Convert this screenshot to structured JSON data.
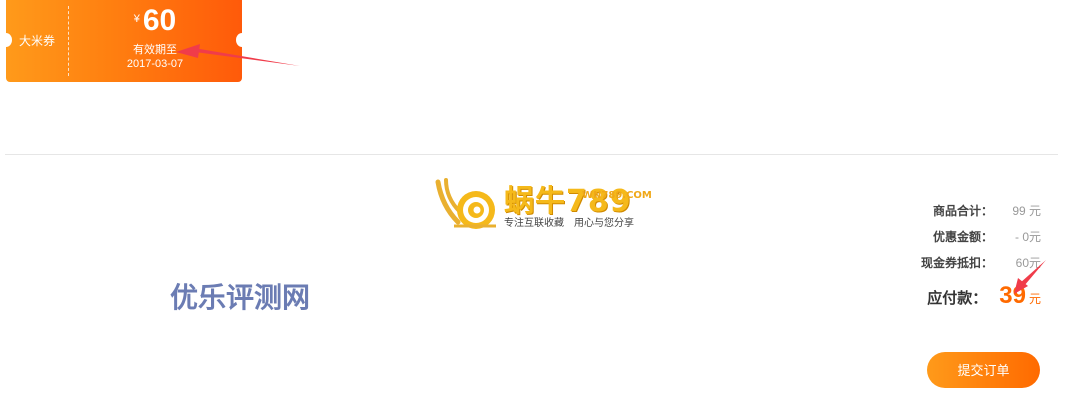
{
  "coupon": {
    "type_label": "大米券",
    "currency": "¥",
    "amount": "60",
    "valid_label": "有效期至",
    "valid_date": "2017-03-07"
  },
  "logo": {
    "brand": "蜗牛789",
    "domain": "WN789.COM",
    "slogan": "专注互联收藏　用心与您分享",
    "icon": "snail-icon"
  },
  "watermark": "优乐评测网",
  "summary": {
    "subtotal_label": "商品合计：",
    "subtotal_value": "99 元",
    "discount_label": "优惠金额：",
    "discount_value": "- 0元",
    "voucher_label": "现金券抵扣：",
    "voucher_value": "60元",
    "payable_label": "应付款：",
    "payable_amount": "39",
    "payable_unit": "元"
  },
  "submit_label": "提交订单",
  "colors": {
    "accent": "#ff6a00",
    "coupon_start": "#ff9a1a",
    "annotation_arrow": "#f03c4a"
  }
}
